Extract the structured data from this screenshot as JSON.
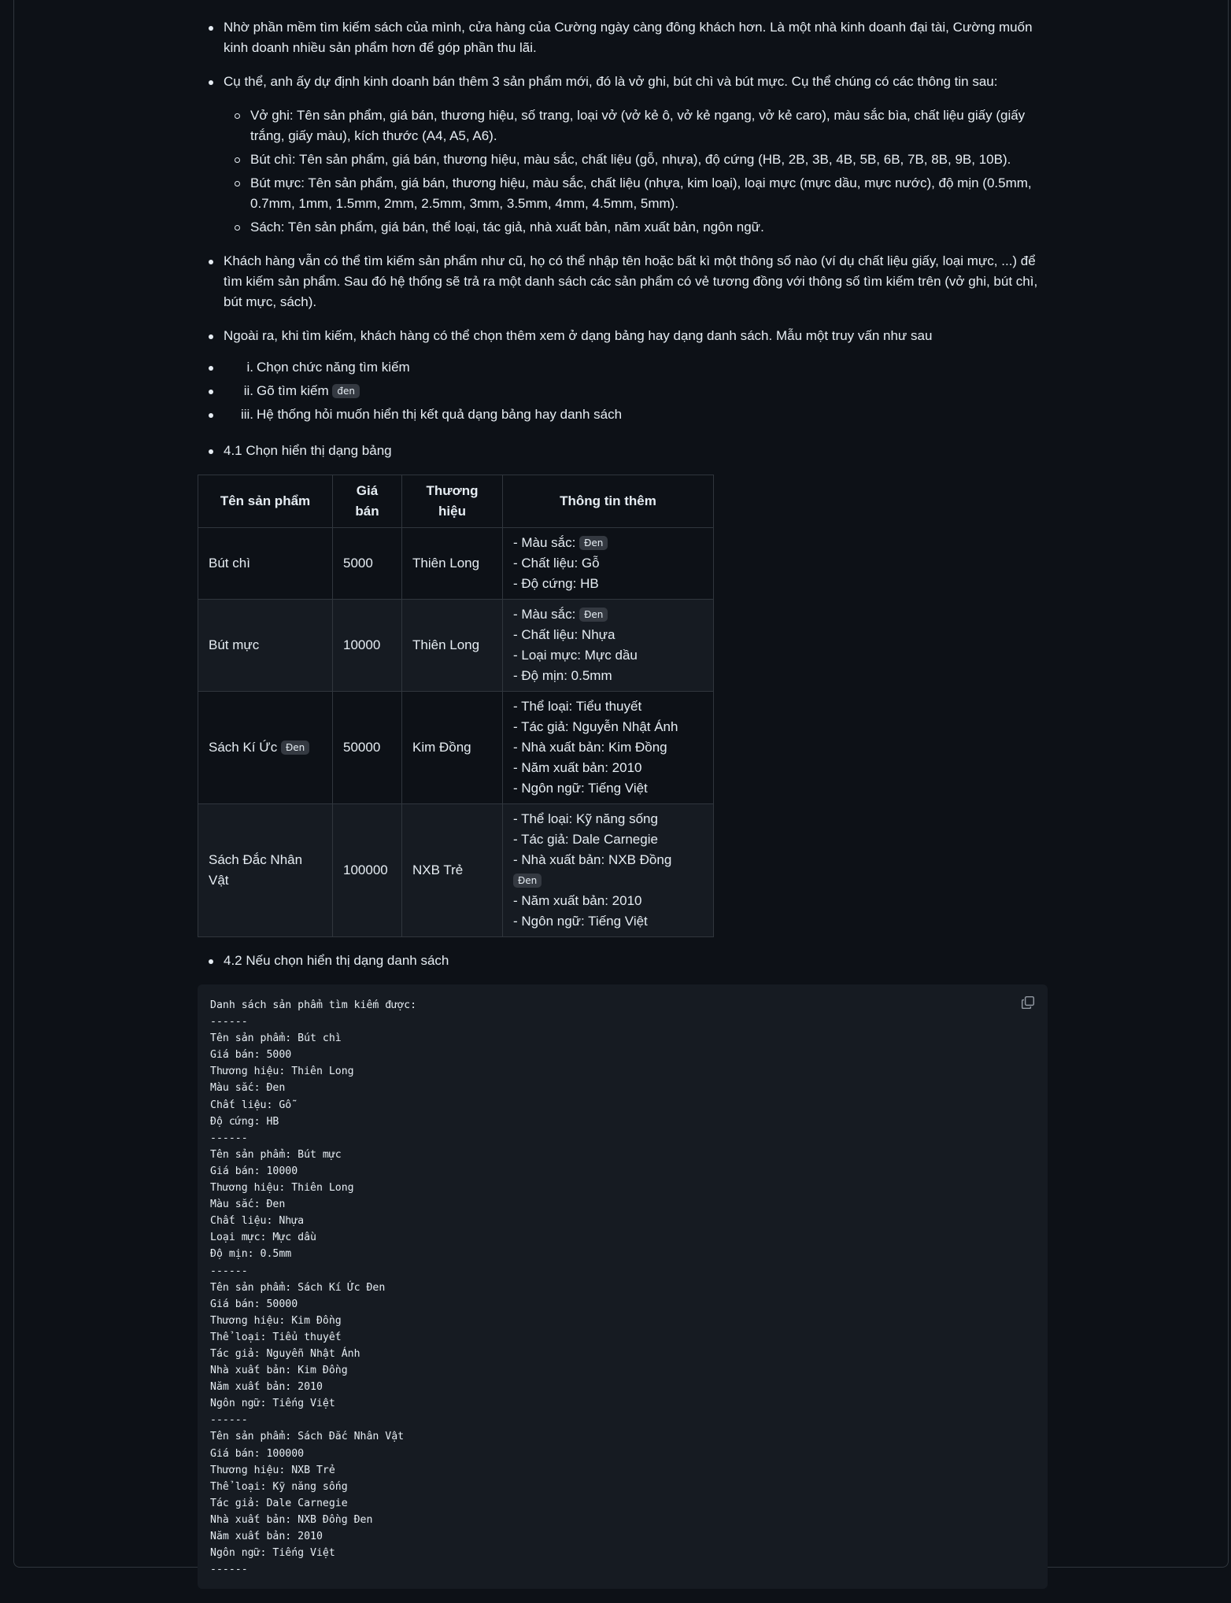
{
  "paragraphs": [
    "Nhờ phần mềm tìm kiếm sách của mình, cửa hàng của Cường ngày càng đông khách hơn. Là một nhà kinh doanh đại tài, Cường muốn kinh doanh nhiều sản phẩm hơn để góp phần thu lãi.",
    "Cụ thể, anh ấy dự định kinh doanh bán thêm 3 sản phẩm mới, đó là vở ghi, bút chì và bút mực. Cụ thể chúng có các thông tin sau:"
  ],
  "product_specs": [
    "Vở ghi: Tên sản phẩm, giá bán, thương hiệu, số trang, loại vở (vở kẻ ô, vở kẻ ngang, vở kẻ caro), màu sắc bìa, chất liệu giấy (giấy trắng, giấy màu), kích thước (A4, A5, A6).",
    "Bút chì: Tên sản phẩm, giá bán, thương hiệu, màu sắc, chất liệu (gỗ, nhựa), độ cứng (HB, 2B, 3B, 4B, 5B, 6B, 7B, 8B, 9B, 10B).",
    "Bút mực: Tên sản phẩm, giá bán, thương hiệu, màu sắc, chất liệu (nhựa, kim loại), loại mực (mực dầu, mực nước), độ mịn (0.5mm, 0.7mm, 1mm, 1.5mm, 2mm, 2.5mm, 3mm, 3.5mm, 4mm, 4.5mm, 5mm).",
    "Sách: Tên sản phẩm, giá bán, thể loại, tác giả, nhà xuất bản, năm xuất bản, ngôn ngữ."
  ],
  "search_paragraph": "Khách hàng vẫn có thể tìm kiếm sản phẩm như cũ, họ có thể nhập tên hoặc bất kì một thông số nào (ví dụ chất liệu giấy, loại mực, ...) để tìm kiếm sản phẩm. Sau đó hệ thống sẽ trả ra một danh sách các sản phẩm có vẻ tương đồng với thông số tìm kiếm trên (vở ghi, bút chì, bút mực, sách).",
  "display_paragraph": "Ngoài ra, khi tìm kiếm, khách hàng có thể chọn thêm xem ở dạng bảng hay dạng danh sách. Mẫu một truy vấn như sau",
  "steps": [
    {
      "num": "i.",
      "text": "Chọn chức năng tìm kiếm",
      "code": ""
    },
    {
      "num": "ii.",
      "text": "Gõ tìm kiếm",
      "code": "đen"
    },
    {
      "num": "iii.",
      "text": "Hệ thống hỏi muốn hiển thị kết quả dạng bảng hay danh sách",
      "code": ""
    }
  ],
  "table_heading": "4.1 Chọn hiển thị dạng bảng",
  "table": {
    "headers": [
      "Tên sản phẩm",
      "Giá bán",
      "Thương hiệu",
      "Thông tin thêm"
    ],
    "rows": [
      {
        "name": "Bút chì",
        "name_code": "",
        "price": "5000",
        "brand": "Thiên Long",
        "info": [
          {
            "text": "- Màu sắc: ",
            "code": "Đen"
          },
          {
            "text": "- Chất liệu: Gỗ",
            "code": ""
          },
          {
            "text": "- Độ cứng: HB",
            "code": ""
          }
        ]
      },
      {
        "name": "Bút mực",
        "name_code": "",
        "price": "10000",
        "brand": "Thiên Long",
        "info": [
          {
            "text": "- Màu sắc: ",
            "code": "Đen"
          },
          {
            "text": "- Chất liệu: Nhựa",
            "code": ""
          },
          {
            "text": "- Loại mực: Mực dầu",
            "code": ""
          },
          {
            "text": "- Độ mịn: 0.5mm",
            "code": ""
          }
        ]
      },
      {
        "name": "Sách Kí Ức ",
        "name_code": "Đen",
        "price": "50000",
        "brand": "Kim Đồng",
        "info": [
          {
            "text": "- Thể loại: Tiểu thuyết",
            "code": ""
          },
          {
            "text": "- Tác giả: Nguyễn Nhật Ánh",
            "code": ""
          },
          {
            "text": "- Nhà xuất bản: Kim Đồng",
            "code": ""
          },
          {
            "text": "- Năm xuất bản: 2010",
            "code": ""
          },
          {
            "text": "- Ngôn ngữ: Tiếng Việt",
            "code": ""
          }
        ]
      },
      {
        "name": "Sách Đắc Nhân Vật",
        "name_code": "",
        "price": "100000",
        "brand": "NXB Trẻ",
        "info": [
          {
            "text": "- Thể loại: Kỹ năng sống",
            "code": ""
          },
          {
            "text": "- Tác giả: Dale Carnegie",
            "code": ""
          },
          {
            "text": "- Nhà xuất bản: NXB Đồng ",
            "code": "Đen"
          },
          {
            "text": "- Năm xuất bản: 2010",
            "code": ""
          },
          {
            "text": "- Ngôn ngữ: Tiếng Việt",
            "code": ""
          }
        ]
      }
    ]
  },
  "list_heading": "4.2 Nếu chọn hiển thị dạng danh sách",
  "code_block": "Danh sách sản phẩm tìm kiếm được:\n------\nTên sản phẩm: Bút chì\nGiá bán: 5000\nThương hiệu: Thiên Long\nMàu sắc: Đen\nChất liệu: Gỗ\nĐộ cứng: HB\n------\nTên sản phẩm: Bút mực\nGiá bán: 10000\nThương hiệu: Thiên Long\nMàu sắc: Đen\nChất liệu: Nhựa\nLoại mực: Mực dầu\nĐộ mịn: 0.5mm\n------\nTên sản phẩm: Sách Kí Ức Đen\nGiá bán: 50000\nThương hiệu: Kim Đồng\nThể loại: Tiểu thuyết\nTác giả: Nguyễn Nhật Ánh\nNhà xuất bản: Kim Đồng\nNăm xuất bản: 2010\nNgôn ngữ: Tiếng Việt\n------\nTên sản phẩm: Sách Đắc Nhân Vật\nGiá bán: 100000\nThương hiệu: NXB Trẻ\nThể loại: Kỹ năng sống\nTác giả: Dale Carnegie\nNhà xuất bản: NXB Đồng Đen\nNăm xuất bản: 2010\nNgôn ngữ: Tiếng Việt\n------",
  "icons": {
    "copy": "copy-icon"
  },
  "colors": {
    "background": "#0d1117",
    "text": "#e6edf3",
    "border": "#30363d",
    "code_bg": "#161b22"
  }
}
